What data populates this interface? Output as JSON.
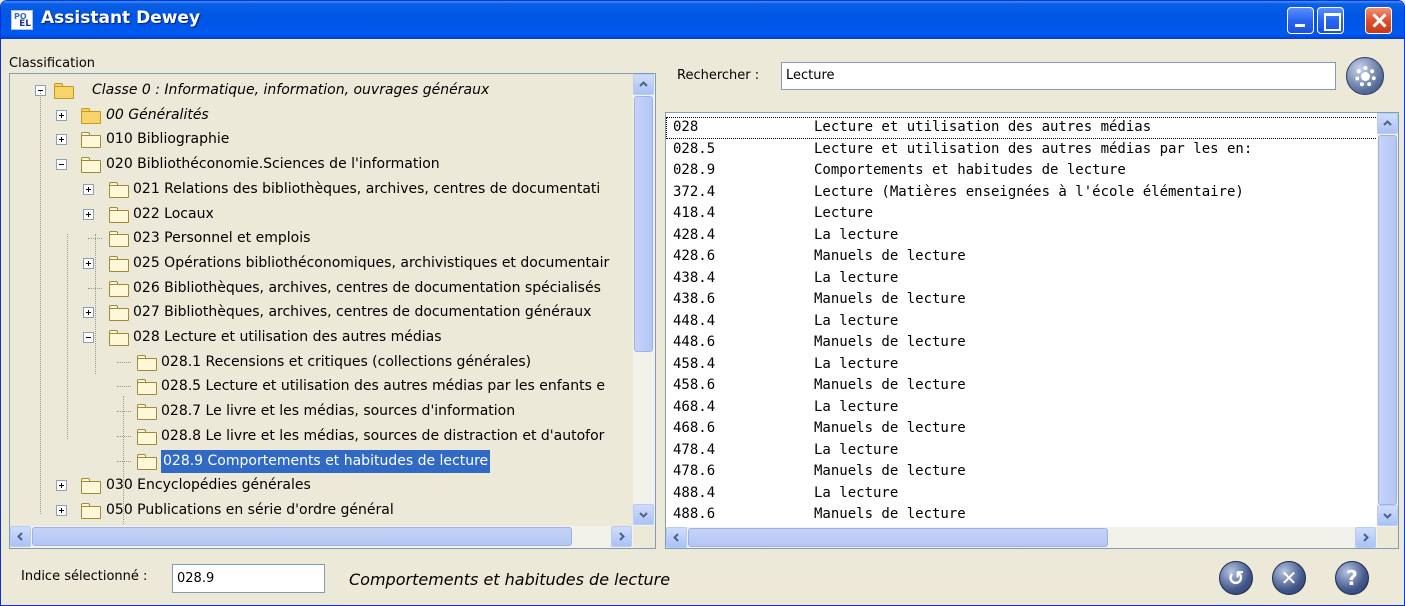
{
  "window": {
    "title": "Assistant Dewey"
  },
  "classification": {
    "label": "Classification",
    "tree": [
      {
        "text": "Classe 0 : Informatique, information, ouvrages généraux",
        "level": 0,
        "expander": "minus",
        "folder": "filled",
        "italic": true
      },
      {
        "text": "00 Généralités",
        "level": 1,
        "expander": "plus",
        "folder": "filled",
        "italic": true
      },
      {
        "text": "010 Bibliographie",
        "level": 1,
        "expander": "plus",
        "folder": "open",
        "italic": false
      },
      {
        "text": "020 Bibliothéconomie.Sciences de l'information",
        "level": 1,
        "expander": "minus",
        "folder": "open",
        "italic": false
      },
      {
        "text": "021 Relations des bibliothèques, archives, centres de documentati",
        "level": 2,
        "expander": "plus",
        "folder": "open",
        "italic": false
      },
      {
        "text": "022 Locaux",
        "level": 2,
        "expander": "plus",
        "folder": "open",
        "italic": false
      },
      {
        "text": "023 Personnel et emplois",
        "level": 2,
        "expander": "none",
        "folder": "open",
        "italic": false
      },
      {
        "text": "025 Opérations bibliothéconomiques, archivistiques et documentair",
        "level": 2,
        "expander": "plus",
        "folder": "open",
        "italic": false
      },
      {
        "text": "026 Bibliothèques, archives, centres de documentation spécialisés",
        "level": 2,
        "expander": "none",
        "folder": "open",
        "italic": false
      },
      {
        "text": "027 Bibliothèques, archives, centres de documentation généraux",
        "level": 2,
        "expander": "plus",
        "folder": "open",
        "italic": false
      },
      {
        "text": "028 Lecture et utilisation des autres médias",
        "level": 2,
        "expander": "minus",
        "folder": "open",
        "italic": false
      },
      {
        "text": "028.1 Recensions et critiques (collections générales)",
        "level": 3,
        "expander": "none",
        "folder": "open",
        "italic": false
      },
      {
        "text": "028.5 Lecture et utilisation des autres médias par les enfants e",
        "level": 3,
        "expander": "none",
        "folder": "open",
        "italic": false
      },
      {
        "text": "028.7 Le livre et les médias, sources d'information",
        "level": 3,
        "expander": "none",
        "folder": "open",
        "italic": false
      },
      {
        "text": "028.8 Le livre et les médias, sources de distraction et d'autofor",
        "level": 3,
        "expander": "none",
        "folder": "open",
        "italic": false
      },
      {
        "text": "028.9 Comportements et habitudes de lecture",
        "level": 3,
        "expander": "none",
        "folder": "open",
        "italic": false,
        "selected": true
      },
      {
        "text": "030 Encyclopédies générales",
        "level": 1,
        "expander": "plus",
        "folder": "open",
        "italic": false
      },
      {
        "text": "050 Publications en série d'ordre général",
        "level": 1,
        "expander": "plus",
        "folder": "open",
        "italic": false
      }
    ]
  },
  "search": {
    "label": "Rechercher :",
    "value": "Lecture"
  },
  "results": [
    {
      "code": "028",
      "label": "Lecture et utilisation des autres médias"
    },
    {
      "code": "028.5",
      "label": "Lecture et utilisation des autres médias par les en:"
    },
    {
      "code": "028.9",
      "label": "Comportements et habitudes de lecture"
    },
    {
      "code": "372.4",
      "label": "Lecture (Matières enseignées à l'école élémentaire)"
    },
    {
      "code": "418.4",
      "label": "Lecture"
    },
    {
      "code": "428.4",
      "label": "La lecture"
    },
    {
      "code": "428.6",
      "label": "Manuels de lecture"
    },
    {
      "code": "438.4",
      "label": "La lecture"
    },
    {
      "code": "438.6",
      "label": "Manuels de lecture"
    },
    {
      "code": "448.4",
      "label": "La lecture"
    },
    {
      "code": "448.6",
      "label": "Manuels de lecture"
    },
    {
      "code": "458.4",
      "label": "La lecture"
    },
    {
      "code": "458.6",
      "label": "Manuels de lecture"
    },
    {
      "code": "468.4",
      "label": "La lecture"
    },
    {
      "code": "468.6",
      "label": "Manuels de lecture"
    },
    {
      "code": "478.4",
      "label": "La lecture"
    },
    {
      "code": "478.6",
      "label": "Manuels de lecture"
    },
    {
      "code": "488.4",
      "label": "La lecture"
    },
    {
      "code": "488.6",
      "label": "Manuels de lecture"
    }
  ],
  "footer": {
    "indice_label": "Indice sélectionné :",
    "indice_value": "028.9",
    "indice_description": "Comportements et habitudes de lecture"
  },
  "colors": {
    "selection": "#316ac5",
    "titlebar": "#0055e5",
    "window_bg": "#ece9d8"
  }
}
